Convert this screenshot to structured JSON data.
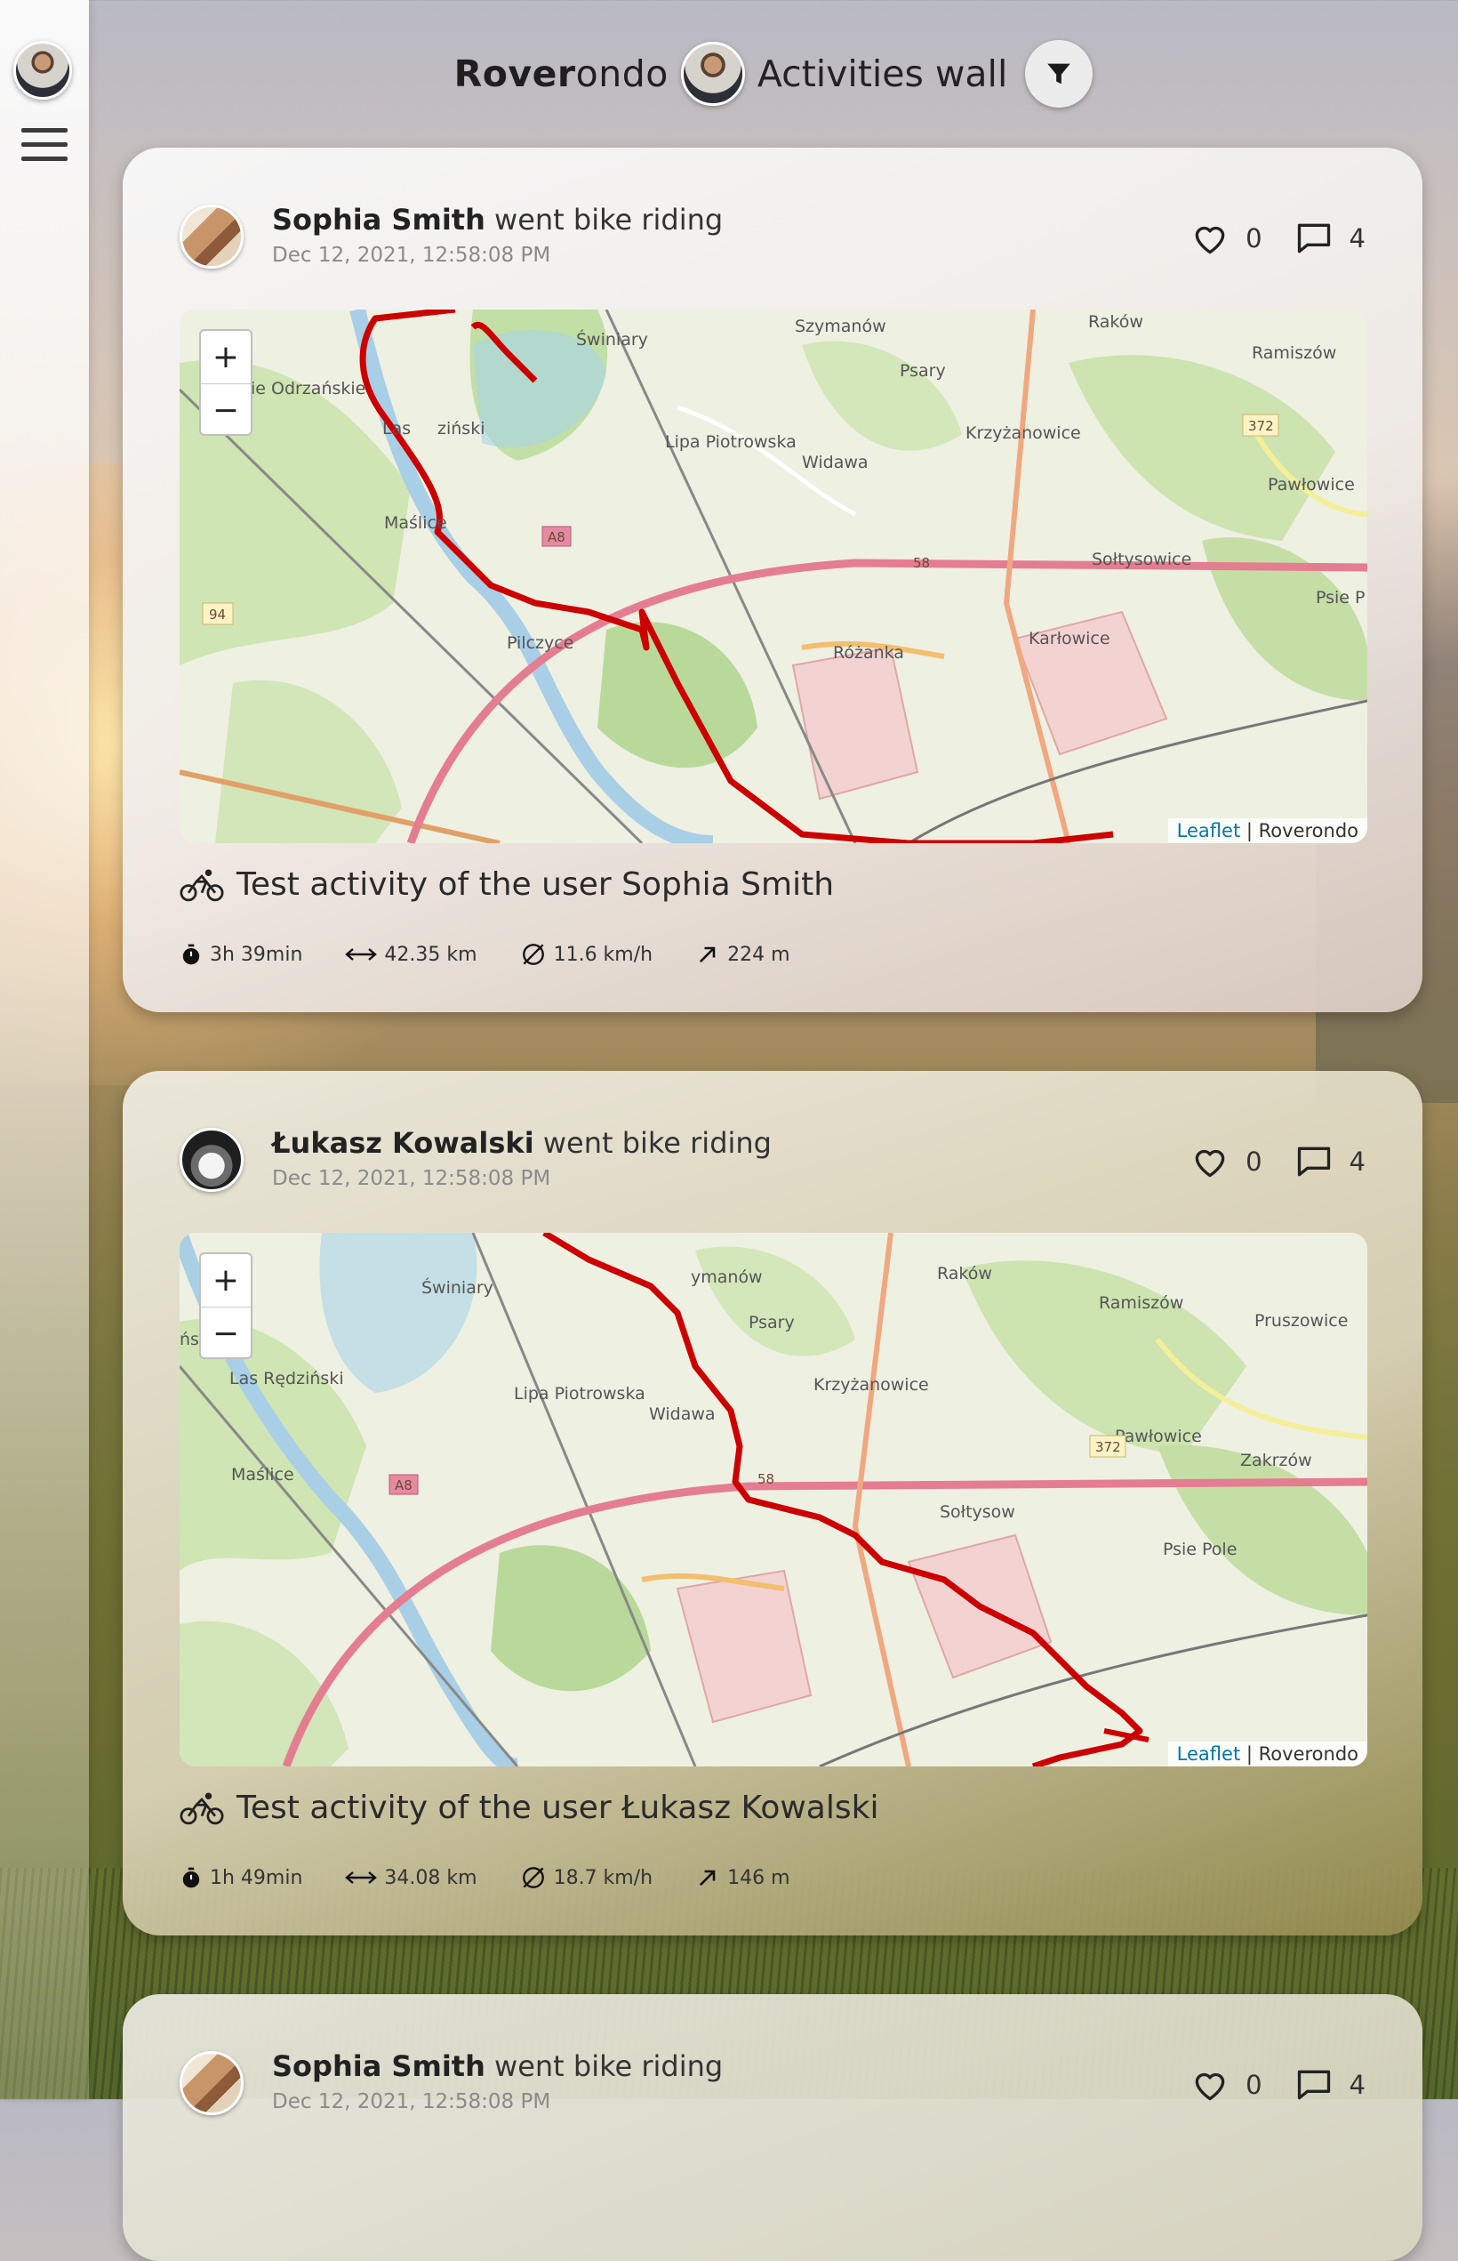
{
  "app": {
    "brand_bold": "Rover",
    "brand_light": "ondo",
    "page_title": "Activities wall"
  },
  "icons": {
    "menu": "hamburger-icon",
    "filter": "filter-icon",
    "like": "heart-icon",
    "comment": "comment-icon",
    "activity": "bicycle-icon",
    "duration": "stopwatch-icon",
    "distance": "distance-arrows-icon",
    "speed": "average-speed-icon",
    "elevation": "elevation-arrow-icon"
  },
  "colors": {
    "route": "#cc0000",
    "leaflet_link": "#0078a8"
  },
  "posts": [
    {
      "user": "Sophia Smith",
      "action": "went bike riding",
      "date": "Dec 12, 2021, 12:58:08 PM",
      "likes": "0",
      "comments": "4",
      "title": "Test activity of the user Sophia Smith",
      "duration": "3h 39min",
      "distance": "42.35 km",
      "avg_speed": "11.6 km/h",
      "elevation": "224 m",
      "map": {
        "zoom_in": "+",
        "zoom_out": "−",
        "attribution_link": "Leaflet",
        "attribution_sep": "|",
        "attribution_owner": "Roverondo",
        "places": [
          "Szymanów",
          "Raków",
          "Świniary",
          "Psary",
          "Ramiszów",
          "ie Odrzańskie",
          "Las",
          "ziński",
          "Lipa Piotrowska",
          "Krzyżanowice",
          "Widawa",
          "Pawłowice",
          "Maślice",
          "Sołtysowice",
          "Psie P",
          "Pilczyce",
          "Różanka",
          "Karłowice"
        ],
        "roads": [
          "372",
          "58",
          "A8",
          "94"
        ]
      }
    },
    {
      "user": "Łukasz Kowalski",
      "action": "went bike riding",
      "date": "Dec 12, 2021, 12:58:08 PM",
      "likes": "0",
      "comments": "4",
      "title": "Test activity of the user Łukasz Kowalski",
      "duration": "1h 49min",
      "distance": "34.08 km",
      "avg_speed": "18.7 km/h",
      "elevation": "146 m",
      "map": {
        "zoom_in": "+",
        "zoom_out": "−",
        "attribution_link": "Leaflet",
        "attribution_sep": "|",
        "attribution_owner": "Roverondo",
        "places": [
          "ymanów",
          "Raków",
          "Świniary",
          "Psary",
          "Ramiszów",
          "Pruszowice",
          "ńskie",
          "Las Rędziński",
          "Lipa Piotrowska",
          "Krzyżanowice",
          "Widawa",
          "Pawłowice",
          "Zakrzów",
          "Maślice",
          "Sołtysow",
          "Psie Pole"
        ],
        "roads": [
          "372",
          "58",
          "A8"
        ]
      }
    },
    {
      "user": "Sophia Smith",
      "action": "went bike riding",
      "date": "Dec 12, 2021, 12:58:08 PM",
      "likes": "0",
      "comments": "4"
    }
  ]
}
